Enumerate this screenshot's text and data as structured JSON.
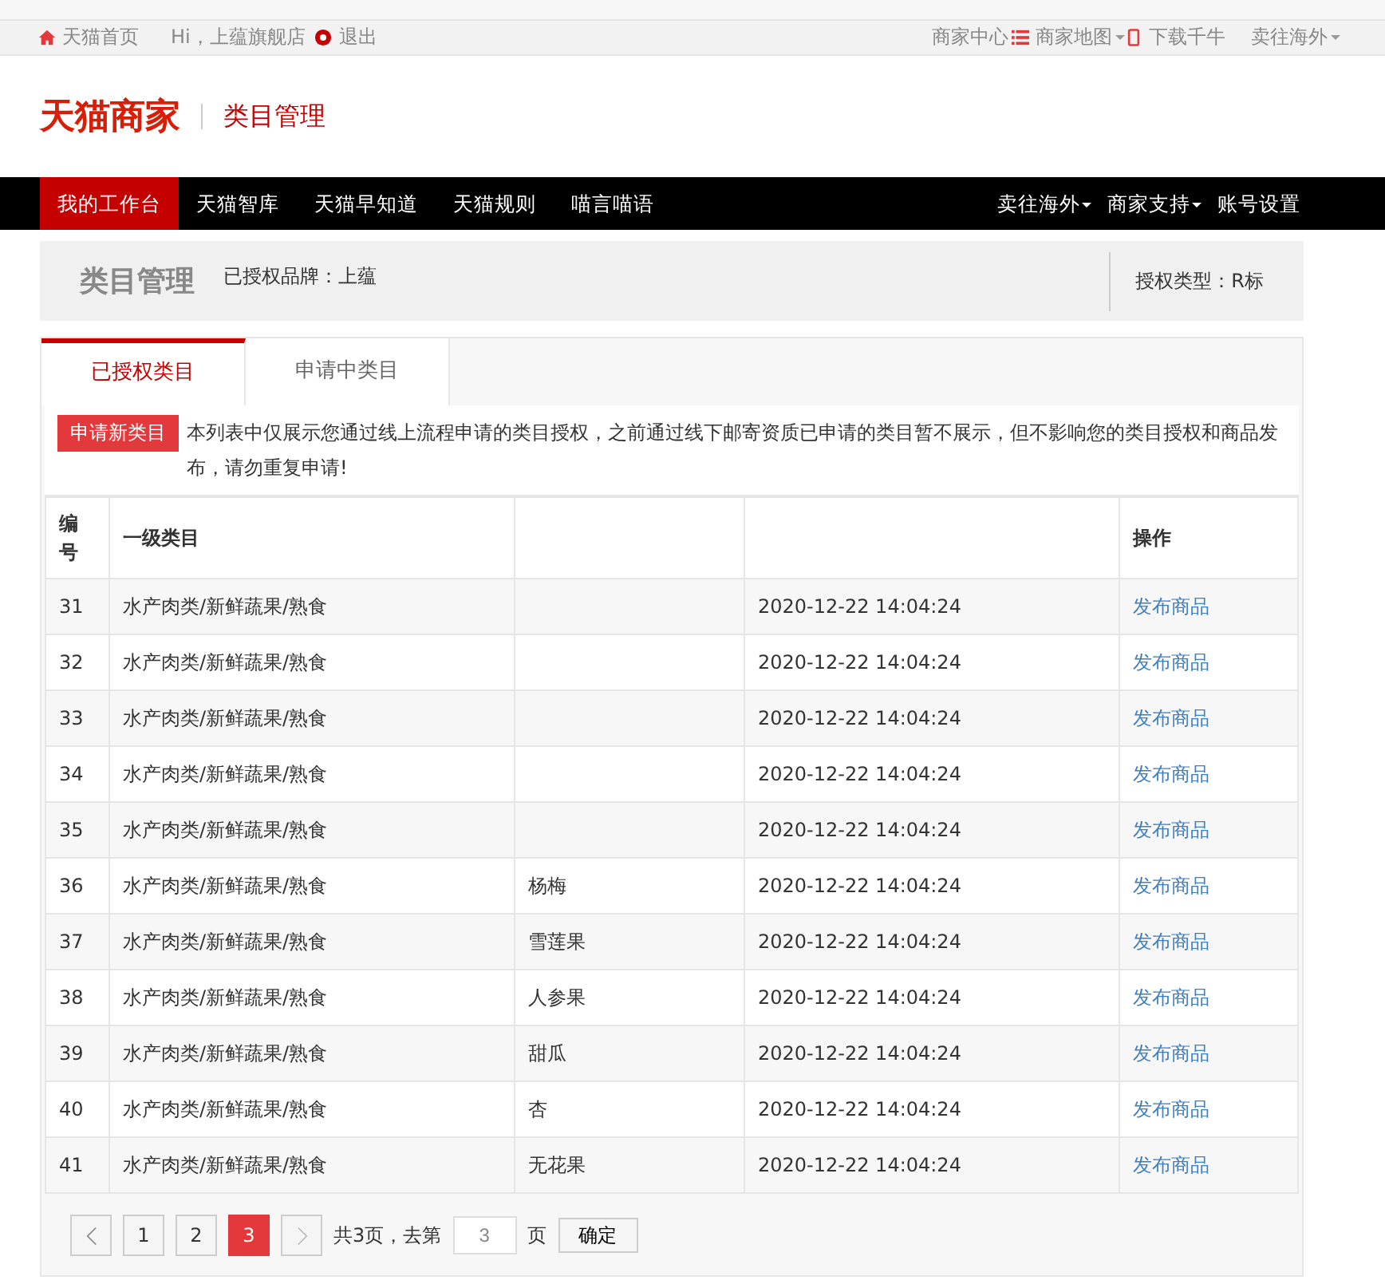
{
  "top_bar": {
    "left": [
      {
        "kind": "home",
        "label": "天猫首页"
      },
      {
        "kind": "text",
        "label": "Hi，上蕴旗舰店"
      },
      {
        "kind": "badge",
        "label": "退出"
      }
    ],
    "right": [
      {
        "kind": "text",
        "label": "商家中心"
      },
      {
        "kind": "list",
        "label": "商家地图"
      },
      {
        "kind": "phone",
        "label": "下载千牛"
      },
      {
        "kind": "dropdown",
        "label": "卖往海外"
      }
    ]
  },
  "header": {
    "logo": "天猫商家",
    "title": "类目管理"
  },
  "nav": {
    "left": [
      {
        "label": "我的工作台",
        "selected": true
      },
      {
        "label": "天猫智库",
        "selected": false
      },
      {
        "label": "天猫早知道",
        "selected": false
      },
      {
        "label": "天猫规则",
        "selected": false
      },
      {
        "label": "喵言喵语",
        "selected": false
      }
    ],
    "right": [
      {
        "label": "卖往海外",
        "dropdown": true
      },
      {
        "label": "商家支持",
        "dropdown": true
      },
      {
        "label": "账号设置",
        "dropdown": false
      }
    ]
  },
  "title_panel": {
    "title": "类目管理",
    "brand": "已授权品牌：上蕴",
    "auth_type": "授权类型：R标"
  },
  "tabs": [
    {
      "label": "已授权类目",
      "selected": true
    },
    {
      "label": "申请中类目",
      "selected": false
    }
  ],
  "apply_button": "申请新类目",
  "notice": "本列表中仅展示您通过线上流程申请的类目授权，之前通过线下邮寄资质已申请的类目暂不展示，但不影响您的类目授权和商品发布，请勿重复申请!",
  "table": {
    "columns": [
      "编号",
      "一级类目",
      "",
      "",
      "操作"
    ],
    "rows": [
      {
        "no": "31",
        "cat1": "水产肉类/新鲜蔬果/熟食",
        "cat2": "",
        "time": "2020-12-22 14:04:24",
        "action": "发布商品"
      },
      {
        "no": "32",
        "cat1": "水产肉类/新鲜蔬果/熟食",
        "cat2": "",
        "time": "2020-12-22 14:04:24",
        "action": "发布商品"
      },
      {
        "no": "33",
        "cat1": "水产肉类/新鲜蔬果/熟食",
        "cat2": "",
        "time": "2020-12-22 14:04:24",
        "action": "发布商品"
      },
      {
        "no": "34",
        "cat1": "水产肉类/新鲜蔬果/熟食",
        "cat2": "",
        "time": "2020-12-22 14:04:24",
        "action": "发布商品"
      },
      {
        "no": "35",
        "cat1": "水产肉类/新鲜蔬果/熟食",
        "cat2": "",
        "time": "2020-12-22 14:04:24",
        "action": "发布商品"
      },
      {
        "no": "36",
        "cat1": "水产肉类/新鲜蔬果/熟食",
        "cat2": "杨梅",
        "time": "2020-12-22 14:04:24",
        "action": "发布商品"
      },
      {
        "no": "37",
        "cat1": "水产肉类/新鲜蔬果/熟食",
        "cat2": "雪莲果",
        "time": "2020-12-22 14:04:24",
        "action": "发布商品"
      },
      {
        "no": "38",
        "cat1": "水产肉类/新鲜蔬果/熟食",
        "cat2": "人参果",
        "time": "2020-12-22 14:04:24",
        "action": "发布商品"
      },
      {
        "no": "39",
        "cat1": "水产肉类/新鲜蔬果/熟食",
        "cat2": "甜瓜",
        "time": "2020-12-22 14:04:24",
        "action": "发布商品"
      },
      {
        "no": "40",
        "cat1": "水产肉类/新鲜蔬果/熟食",
        "cat2": "杏",
        "time": "2020-12-22 14:04:24",
        "action": "发布商品"
      },
      {
        "no": "41",
        "cat1": "水产肉类/新鲜蔬果/熟食",
        "cat2": "无花果",
        "time": "2020-12-22 14:04:24",
        "action": "发布商品"
      }
    ]
  },
  "pagination": {
    "pages": [
      {
        "label": "1",
        "selected": false
      },
      {
        "label": "2",
        "selected": false
      },
      {
        "label": "3",
        "selected": true
      }
    ],
    "total": "共3页，去第",
    "input_value": "3",
    "suffix": "页",
    "confirm": "确定"
  }
}
